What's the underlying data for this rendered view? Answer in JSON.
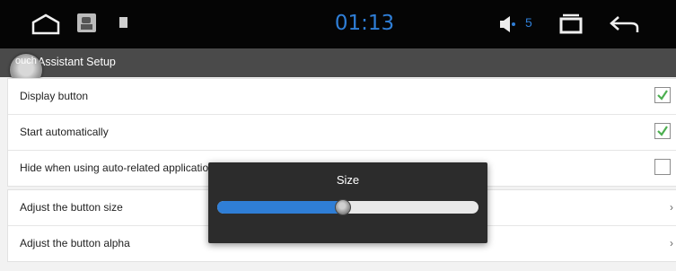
{
  "statusbar": {
    "time": "01:13",
    "volume": "5",
    "icons": [
      "home-icon",
      "gallery-icon",
      "small-square-icon",
      "volume-icon",
      "recent-apps-icon",
      "back-icon"
    ]
  },
  "titlebar": {
    "title": "Assistant Setup",
    "prefix": "ouch"
  },
  "settings": [
    {
      "label": "Display button",
      "checked": true
    },
    {
      "label": "Start automatically",
      "checked": true
    },
    {
      "label": "Hide when using auto-related applications",
      "checked": false
    }
  ],
  "adjust": [
    {
      "label": "Adjust the button size"
    },
    {
      "label": "Adjust the button alpha"
    }
  ],
  "dialog": {
    "title": "Size",
    "value": 0.48
  },
  "colors": {
    "accent": "#2f7ed6",
    "check": "#4caf50"
  }
}
